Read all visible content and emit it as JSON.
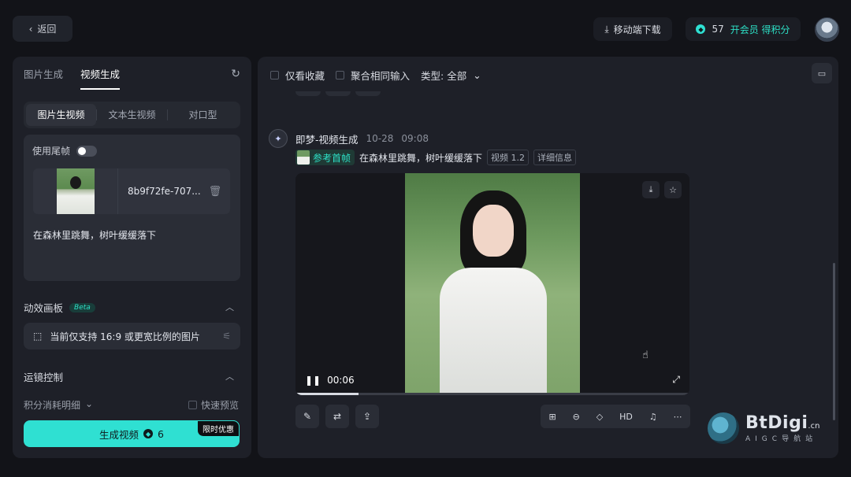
{
  "topbar": {
    "back_label": "返回",
    "download_label": "移动端下载",
    "credits": "57",
    "vip_label": "开会员 得积分"
  },
  "left": {
    "tabs": [
      "图片生成",
      "视频生成"
    ],
    "segments": [
      "图片生视频",
      "文本生视频",
      "对口型"
    ],
    "tail_frame_label": "使用尾帧",
    "file_name": "8b9f72fe-707...",
    "prompt": "在森林里跳舞，树叶缓缓落下",
    "effect_title": "动效画板",
    "beta": "Beta",
    "effect_hint": "当前仅支持 16:9 或更宽比例的图片",
    "camera_title": "运镜控制",
    "points_detail": "积分消耗明细",
    "fast_preview": "快速预览",
    "generate_label": "生成视频",
    "generate_cost": "6",
    "promo": "限时优惠"
  },
  "right": {
    "filters": {
      "favorites": "仅看收藏",
      "merge": "聚合相同输入",
      "type": "类型: 全部"
    },
    "item": {
      "source": "即梦-视频生成",
      "date": "10-28",
      "time": "09:08",
      "ref_label": "参考首帧",
      "prompt": "在森林里跳舞，树叶缓缓落下",
      "model_tag": "视频 1.2",
      "detail_tag": "详细信息",
      "timecode": "00:06",
      "progress": 0.16,
      "hd_label": "HD"
    }
  },
  "watermark": {
    "title": "BtDigi",
    "suffix": ".cn",
    "sub": "AIGC导航站"
  },
  "colors": {
    "accent": "#2fe0d2",
    "vip": "#2de0c6",
    "panel": "#1e2028"
  }
}
